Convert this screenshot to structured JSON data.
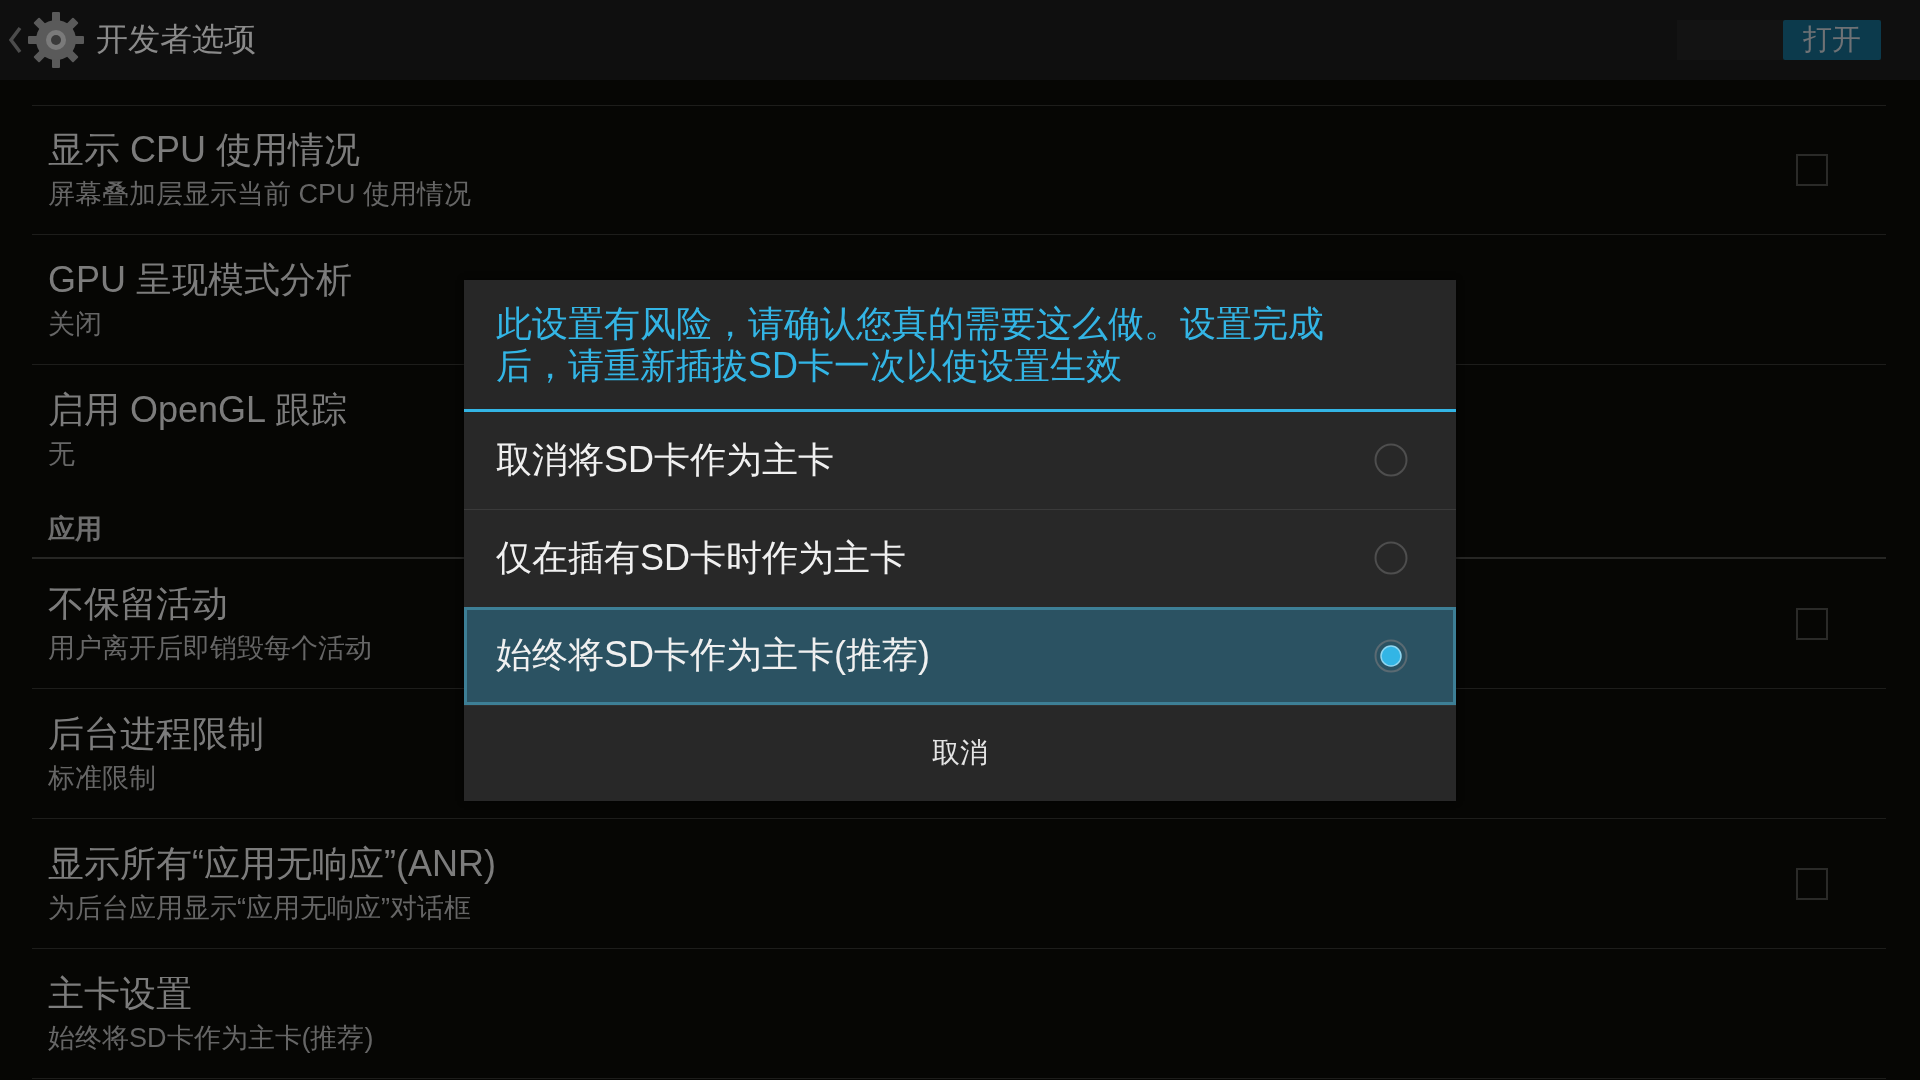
{
  "action_bar": {
    "title": "开发者选项",
    "switch": {
      "label": "打开",
      "on": true
    }
  },
  "settings": [
    {
      "kind": "checkbox",
      "title": "显示 CPU 使用情况",
      "summary": "屏幕叠加层显示当前 CPU 使用情况",
      "checked": false
    },
    {
      "kind": "option",
      "title": "GPU 呈现模式分析",
      "summary": "关闭"
    },
    {
      "kind": "option",
      "title": "启用 OpenGL 跟踪",
      "summary": "无"
    },
    {
      "kind": "header",
      "title": "应用"
    },
    {
      "kind": "checkbox",
      "title": "不保留活动",
      "summary": "用户离开后即销毁每个活动",
      "checked": false
    },
    {
      "kind": "option",
      "title": "后台进程限制",
      "summary": "标准限制"
    },
    {
      "kind": "checkbox",
      "title": "显示所有“应用无响应”(ANR)",
      "summary": "为后台应用显示“应用无响应”对话框",
      "checked": false
    },
    {
      "kind": "option",
      "title": "主卡设置",
      "summary": "始终将SD卡作为主卡(推荐)"
    }
  ],
  "dialog": {
    "message": "此设置有风险，请确认您真的需要这么做。设置完成后，请重新插拔SD卡一次以使设置生效",
    "options": [
      {
        "label": "取消将SD卡作为主卡",
        "selected": false
      },
      {
        "label": "仅在插有SD卡时作为主卡",
        "selected": false
      },
      {
        "label": "始终将SD卡作为主卡(推荐)",
        "selected": true
      }
    ],
    "cancel": "取消"
  }
}
